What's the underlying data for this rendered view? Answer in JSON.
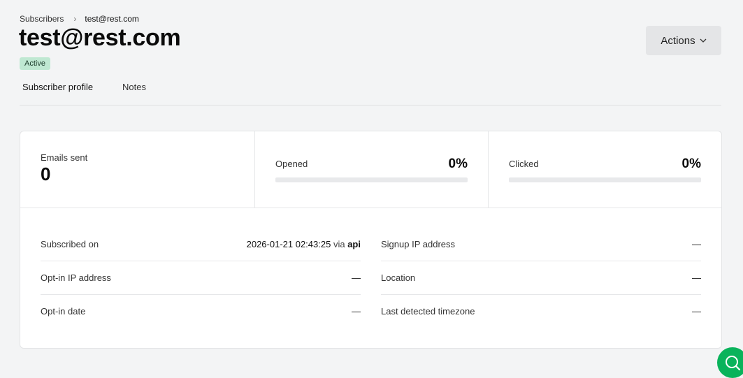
{
  "breadcrumb": {
    "parent": "Subscribers",
    "separator": "›",
    "current": "test@rest.com"
  },
  "title": "test@rest.com",
  "status": {
    "label": "Active",
    "color": "#bfe8d2"
  },
  "actions": {
    "label": "Actions",
    "icon": "chevron-down-icon"
  },
  "tabs": [
    {
      "label": "Subscriber profile",
      "active": true
    },
    {
      "label": "Notes",
      "active": false
    }
  ],
  "stats": {
    "emails_sent": {
      "label": "Emails sent",
      "value": "0"
    },
    "opened": {
      "label": "Opened",
      "value": "0%",
      "progress": 0
    },
    "clicked": {
      "label": "Clicked",
      "value": "0%",
      "progress": 0
    }
  },
  "details": {
    "left": [
      {
        "label": "Subscribed on",
        "value": "2026-01-21 02:43:25",
        "via": "via",
        "source": "api"
      },
      {
        "label": "Opt-in IP address",
        "value": "—"
      },
      {
        "label": "Opt-in date",
        "value": "—"
      }
    ],
    "right": [
      {
        "label": "Signup IP address",
        "value": "—"
      },
      {
        "label": "Location",
        "value": "—"
      },
      {
        "label": "Last detected timezone",
        "value": "—"
      }
    ]
  },
  "colors": {
    "accent": "#09b35b",
    "background": "#f3f4f5"
  },
  "help": {
    "icon": "chat-search-icon"
  }
}
